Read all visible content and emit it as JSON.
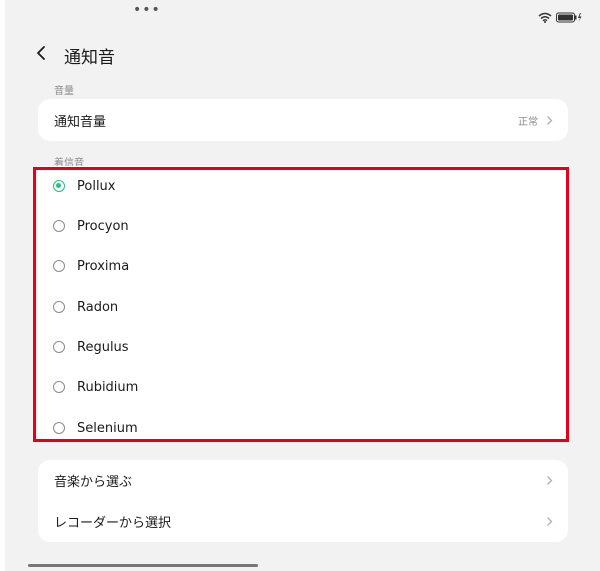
{
  "status_bar": {
    "dots": "•••",
    "wifi_icon": "wifi-icon",
    "battery_icon": "battery-charging-icon"
  },
  "header": {
    "back_icon": "chevron-left-icon",
    "title": "通知音"
  },
  "volume_section": {
    "label": "音量",
    "row_label": "通知音量",
    "row_value": "正常"
  },
  "ringtone_section": {
    "label": "着信音",
    "selected": "Pollux",
    "items": [
      {
        "label": "Pollux"
      },
      {
        "label": "Procyon"
      },
      {
        "label": "Proxima"
      },
      {
        "label": "Radon"
      },
      {
        "label": "Regulus"
      },
      {
        "label": "Rubidium"
      },
      {
        "label": "Selenium"
      }
    ]
  },
  "source_section": {
    "items": [
      {
        "label": "音楽から選ぶ"
      },
      {
        "label": "レコーダーから選択"
      }
    ]
  },
  "colors": {
    "accent": "#20c57e",
    "highlight": "#e3001b",
    "background": "#f2f2f2"
  }
}
